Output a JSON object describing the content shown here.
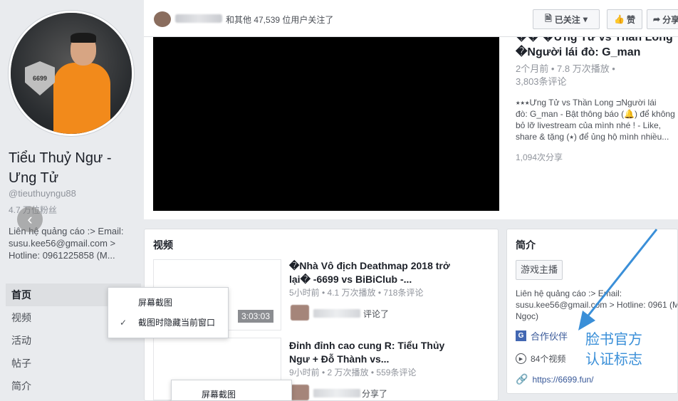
{
  "sidebar": {
    "page_name": "Tiểu Thuỷ Ngư - Ưng Tử",
    "handle": "@tieuthuyngu88",
    "followers": "4.7 万位粉丝",
    "contact": "Liên hệ quảng cáo :> Email: susu.kee56@gmail.com > Hotline: 0961225858 (M...",
    "avatar_badge_text": "6699",
    "nav": [
      {
        "label": "首页",
        "active": true
      },
      {
        "label": "视频",
        "active": false
      },
      {
        "label": "活动",
        "active": false
      },
      {
        "label": "帖子",
        "active": false
      },
      {
        "label": "简介",
        "active": false
      }
    ]
  },
  "topbar": {
    "follow_text": "和其他 47,539 位用户关注了",
    "followed_label": "已关注",
    "like_label": "赞",
    "share_label": "分享"
  },
  "featured_video": {
    "title_line1": "�� �Ưng Tử vs Thần Long",
    "title_line2": "�Người lái đò: G_man",
    "meta_line1": "2个月前 • 7.8 万次播放 •",
    "meta_line2": "3,803条评论",
    "description_lines": [
      "⭑⭑⭑Ưng Tử vs Thần Long ⊐Người lái",
      "đò: G_man - Bật thông báo (🔔) để không",
      "bỏ lỡ livestream của mình nhé ! - Like,",
      "share & tặng (⭑) để ủng hộ mình nhiều..."
    ],
    "shares": "1,094次分享"
  },
  "videos_section": {
    "heading": "视频",
    "items": [
      {
        "duration": "3:03:03",
        "title": "�Nhà Vô địch Deathmap 2018 trở lại� -6699 vs BiBiClub -...",
        "meta": "5小时前 • 4.1 万次播放 • 718条评论",
        "activity": "评论了"
      },
      {
        "duration": "",
        "title": "Đỉnh đỉnh cao cung R: Tiểu Thủy Ngư + Đỗ Thành vs...",
        "meta": "9小时前 • 2 万次播放 • 559条评论",
        "activity": "分享了"
      }
    ]
  },
  "intro": {
    "heading": "简介",
    "category": "游戏主播",
    "contact": "Liên hệ quảng cáo :> Email: susu.kee56@gmail.com > Hotline: 0961 (Mrs Ngọc)",
    "partner_label": "合作伙伴",
    "videos_count": "84个视频",
    "website": "https://6699.fun/"
  },
  "annotation": {
    "line1": "脸书官方",
    "line2": "认证标志",
    "color": "#3a8fd8"
  },
  "context_menu_1": {
    "items": [
      {
        "label": "屏幕截图",
        "checked": false
      },
      {
        "label": "截图时隐藏当前窗口",
        "checked": true
      }
    ]
  },
  "context_menu_2": {
    "items": [
      {
        "label": "屏幕截图"
      }
    ]
  },
  "colors": {
    "page_bg": "#e9ebee",
    "link": "#385898",
    "partner_blue": "#4267b2",
    "avatar_shirt": "#f28a1b"
  }
}
